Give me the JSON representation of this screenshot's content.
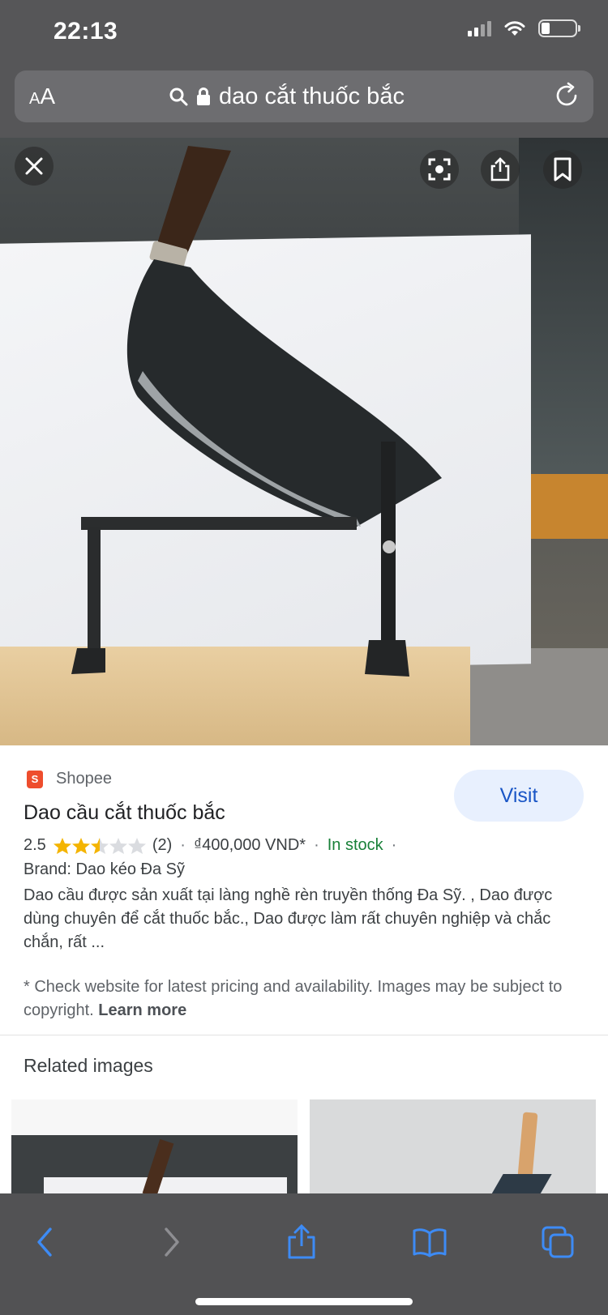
{
  "status_bar": {
    "time": "22:13"
  },
  "address_bar": {
    "text_size_label": "AA",
    "url_text": "dao cắt thuốc bắc"
  },
  "result": {
    "source": "Shopee",
    "visit_label": "Visit",
    "title": "Dao cầu cắt thuốc bắc",
    "rating": "2.5",
    "rating_value": 2.5,
    "rating_max": 5,
    "review_count": "(2)",
    "price": "₫400,000 VND*",
    "availability": "In stock",
    "separator": "·",
    "brand": "Brand: Dao kéo Đa Sỹ",
    "description": "Dao cầu được sản xuất tại làng nghề rèn truyền thống Đa Sỹ. , Dao được dùng chuyên để cắt thuốc bắc., Dao được làm rất chuyên nghiệp và chắc chắn, rất ...",
    "disclaimer_text": "* Check website for latest pricing and availability. Images may be subject to copyright.",
    "learn_more": "Learn more"
  },
  "related": {
    "title": "Related images"
  },
  "colors": {
    "chrome": "#565658",
    "accent_blue": "#2f7de1",
    "visit_bg": "#e8f0fe",
    "in_stock": "#188038",
    "star": "#f4b400"
  }
}
